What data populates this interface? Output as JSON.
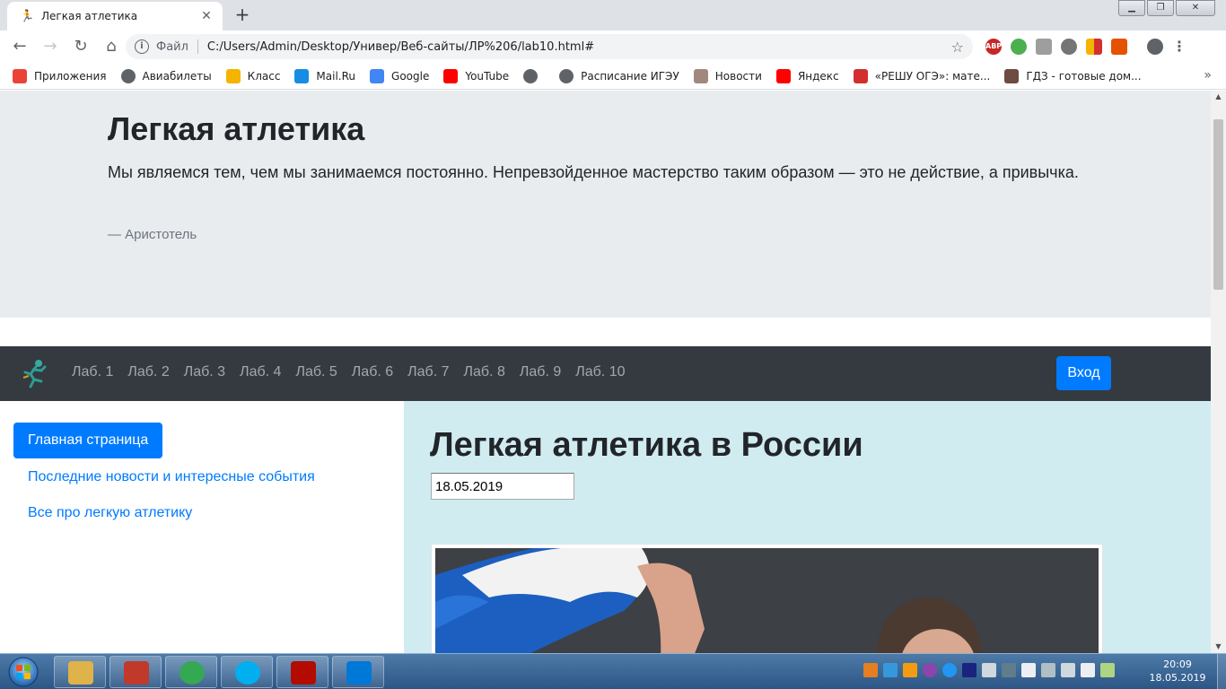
{
  "browser": {
    "tab": {
      "title": "Легкая атлетика",
      "icon": "runner-favicon-icon"
    },
    "new_tab_icon": "+",
    "omnibox": {
      "scheme_label": "Файл",
      "url": "C:/Users/Admin/Desktop/Универ/Веб-сайты/ЛР%206/lab10.html#"
    },
    "bookmarks": [
      {
        "label": "Приложения",
        "icon": "apps-grid-icon",
        "color": "#ea4335"
      },
      {
        "label": "Авиабилеты",
        "icon": "globe-icon",
        "color": "#5f6368"
      },
      {
        "label": "Класс",
        "icon": "classroom-icon",
        "color": "#f4b400"
      },
      {
        "label": "Mail.Ru",
        "icon": "mailru-icon",
        "color": "#168de2"
      },
      {
        "label": "Google",
        "icon": "google-icon",
        "color": "#4285f4"
      },
      {
        "label": "YouTube",
        "icon": "youtube-icon",
        "color": "#ff0000"
      },
      {
        "label": "",
        "icon": "globe-icon",
        "color": "#5f6368"
      },
      {
        "label": "Расписание ИГЭУ",
        "icon": "globe-icon",
        "color": "#5f6368"
      },
      {
        "label": "Новости",
        "icon": "news-icon",
        "color": "#a1887f"
      },
      {
        "label": "Яндекс",
        "icon": "yandex-icon",
        "color": "#ff0000"
      },
      {
        "label": "«РЕШУ ОГЭ»: мате...",
        "icon": "reshu-oge-icon",
        "color": "#d32f2f"
      },
      {
        "label": "ГДЗ - готовые дом...",
        "icon": "gdz-icon",
        "color": "#6d4c41"
      }
    ]
  },
  "page": {
    "jumbotron": {
      "title": "Легкая атлетика",
      "quote": "Мы являемся тем, чем мы занимаемся постоянно. Непревзойденное мастерство таким образом — это не действие, а привычка.",
      "author": "—  Аристотель"
    },
    "navbar": {
      "links": [
        "Лаб. 1",
        "Лаб. 2",
        "Лаб. 3",
        "Лаб. 4",
        "Лаб. 5",
        "Лаб. 6",
        "Лаб. 7",
        "Лаб. 8",
        "Лаб. 9",
        "Лаб. 10"
      ],
      "login_label": "Вход"
    },
    "sidebar": {
      "active": "Главная страница",
      "links": [
        "Последние новости и интересные события",
        "Все про легкую атлетику"
      ]
    },
    "content": {
      "title": "Легкая атлетика в России",
      "date_value": "18.05.2019"
    }
  },
  "taskbar": {
    "apps": [
      {
        "name": "explorer",
        "icon": "folder-icon",
        "color": "#e0b24a"
      },
      {
        "name": "app",
        "icon": "app-icon",
        "color": "#c0392b"
      },
      {
        "name": "chrome",
        "icon": "chrome-icon",
        "color": "#34a853"
      },
      {
        "name": "skype",
        "icon": "skype-icon",
        "color": "#00aff0"
      },
      {
        "name": "acrobat",
        "icon": "acrobat-icon",
        "color": "#b30b00"
      },
      {
        "name": "vscode",
        "icon": "vscode-icon",
        "color": "#0078d7"
      }
    ],
    "clock": {
      "time": "20:09",
      "date": "18.05.2019"
    }
  }
}
